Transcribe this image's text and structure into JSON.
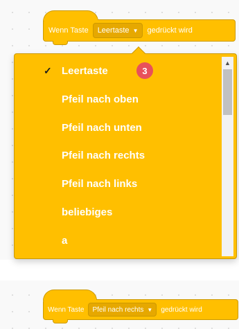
{
  "top_block": {
    "prefix": "Wenn Taste",
    "selected_key": "Leertaste",
    "suffix": "gedrückt wird"
  },
  "dropdown": {
    "items": [
      {
        "label": "Leertaste",
        "checked": true
      },
      {
        "label": "Pfeil nach oben"
      },
      {
        "label": "Pfeil nach unten"
      },
      {
        "label": "Pfeil nach rechts"
      },
      {
        "label": "Pfeil nach links"
      },
      {
        "label": "beliebiges"
      },
      {
        "label": "a"
      }
    ],
    "check_mark": "✓",
    "step_badge": "3",
    "scroll_up_arrow": "▲"
  },
  "bottom_block": {
    "prefix": "Wenn Taste",
    "selected_key": "Pfeil nach rechts",
    "suffix": "gedrückt wird"
  },
  "colors": {
    "event_block": "#ffbf00",
    "event_border": "#cc9900",
    "badge": "#e8505b"
  },
  "icons": {
    "dropdown_arrow": "▼"
  }
}
